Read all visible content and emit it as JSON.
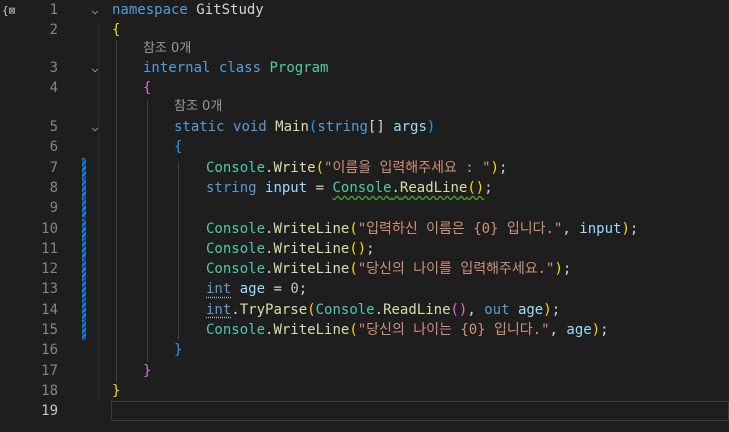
{
  "editor": {
    "lines": [
      {
        "n": "1",
        "fold": "⌵"
      },
      {
        "n": "2"
      },
      {
        "n": "",
        "ref": "참조 0개"
      },
      {
        "n": "3",
        "fold": "⌵"
      },
      {
        "n": "4"
      },
      {
        "n": "",
        "ref": "참조 0개"
      },
      {
        "n": "5",
        "fold": "⌵"
      },
      {
        "n": "6"
      },
      {
        "n": "7"
      },
      {
        "n": "8"
      },
      {
        "n": "9"
      },
      {
        "n": "10"
      },
      {
        "n": "11"
      },
      {
        "n": "12"
      },
      {
        "n": "13"
      },
      {
        "n": "14"
      },
      {
        "n": "15"
      },
      {
        "n": "16"
      },
      {
        "n": "17"
      },
      {
        "n": "18"
      },
      {
        "n": "19"
      }
    ],
    "tokens": {
      "namespace": "namespace",
      "ns_name": "GitStudy",
      "internal": "internal",
      "class": "class",
      "class_name": "Program",
      "static": "static",
      "void": "void",
      "main": "Main",
      "string": "string",
      "args": "args",
      "console": "Console",
      "write": "Write",
      "writeline": "WriteLine",
      "readline": "ReadLine",
      "input": "input",
      "int": "int",
      "age": "age",
      "zero": "0",
      "tryparse": "TryParse",
      "out": "out",
      "str1": "\"이름을 입력해주세요 : \"",
      "str2": "\"입력하신 이름은 {0} 입니다.\"",
      "str3": "\"당신의 나이를 입력해주세요.\"",
      "str4": "\"당신의 나이는 {0} 입니다.\""
    },
    "margin_icon": "{⊠"
  }
}
